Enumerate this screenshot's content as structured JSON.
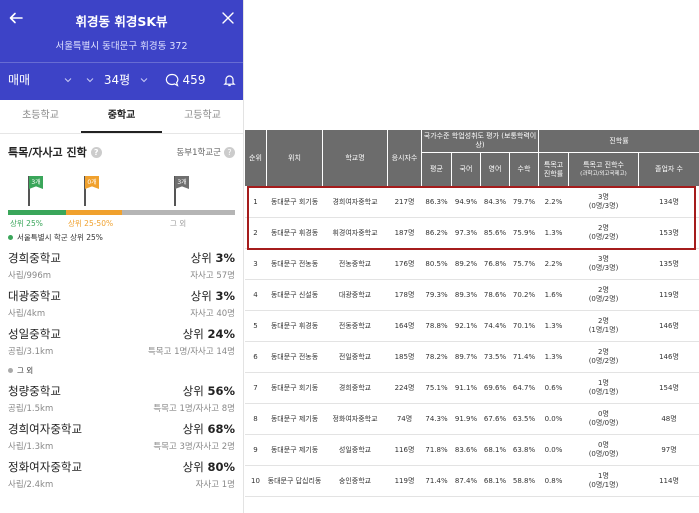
{
  "header": {
    "title": "휘경동 휘경SK뷰",
    "address": "서울특별시 동대문구 휘경동 372",
    "deal_type": "매매",
    "size": "34평",
    "talk_count": "459",
    "bg_color": "#3d43c7"
  },
  "tabs": [
    {
      "label": "초등학교"
    },
    {
      "label": "중학교",
      "active": true
    },
    {
      "label": "고등학교"
    }
  ],
  "section": {
    "title": "특목/자사고 진학",
    "district": "동부1학교군"
  },
  "flags": {
    "green": "3개",
    "orange": "0개",
    "gray": "3개"
  },
  "bar_labels": {
    "top25": "상위 25%",
    "top25_50": "상위 25-50%",
    "other": "그 외"
  },
  "groups": {
    "top_label": "서울특별시 학군 상위 25%",
    "other_label": "그 외"
  },
  "schools_top": [
    {
      "name": "경희중학교",
      "rank_prefix": "상위 ",
      "rank": "3%",
      "info": "사립/996m",
      "detail": "자사고 57명"
    },
    {
      "name": "대광중학교",
      "rank_prefix": "상위 ",
      "rank": "3%",
      "info": "사립/4km",
      "detail": "자사고 40명"
    },
    {
      "name": "성일중학교",
      "rank_prefix": "상위 ",
      "rank": "24%",
      "info": "공립/3.1km",
      "detail": "특목고 1명/자사고 14명"
    }
  ],
  "schools_other": [
    {
      "name": "청량중학교",
      "rank_prefix": "상위 ",
      "rank": "56%",
      "info": "공립/1.5km",
      "detail": "특목고 1명/자사고 8명"
    },
    {
      "name": "경희여자중학교",
      "rank_prefix": "상위 ",
      "rank": "68%",
      "info": "사립/1.3km",
      "detail": "특목고 3명/자사고 2명"
    },
    {
      "name": "정화여자중학교",
      "rank_prefix": "상위 ",
      "rank": "80%",
      "info": "사립/2.4km",
      "detail": "자사고 1명"
    }
  ],
  "table": {
    "headers": {
      "rank": "순위",
      "location": "위치",
      "school": "학교명",
      "applicants": "응시자수",
      "national_group": "국가수준 학업성취도 평가 (보통학력이상)",
      "avg": "평균",
      "korean": "국어",
      "english": "영어",
      "math": "수학",
      "advance_group": "진학률",
      "special_rate": "특목고 진학률",
      "special_count": "특목고 진학수",
      "special_count_sub": "(과학고/외고국제고)",
      "graduates": "졸업자 수"
    },
    "rows": [
      {
        "rank": "1",
        "loc": "동대문구 회기동",
        "school": "경희여자중학교",
        "app": "217명",
        "avg": "86.3%",
        "kor": "94.9%",
        "eng": "84.3%",
        "math": "79.7%",
        "rate": "2.2%",
        "cnt": "3명",
        "cnt_sub": "(0명/3명)",
        "grad": "134명"
      },
      {
        "rank": "2",
        "loc": "동대문구 휘경동",
        "school": "휘경여자중학교",
        "app": "187명",
        "avg": "86.2%",
        "kor": "97.3%",
        "eng": "85.6%",
        "math": "75.9%",
        "rate": "1.3%",
        "cnt": "2명",
        "cnt_sub": "(0명/2명)",
        "grad": "153명"
      },
      {
        "rank": "3",
        "loc": "동대문구 전농동",
        "school": "전농중학교",
        "app": "176명",
        "avg": "80.5%",
        "kor": "89.2%",
        "eng": "76.8%",
        "math": "75.7%",
        "rate": "2.2%",
        "cnt": "3명",
        "cnt_sub": "(0명/3명)",
        "grad": "135명"
      },
      {
        "rank": "4",
        "loc": "동대문구 신설동",
        "school": "대광중학교",
        "app": "178명",
        "avg": "79.3%",
        "kor": "89.3%",
        "eng": "78.6%",
        "math": "70.2%",
        "rate": "1.6%",
        "cnt": "2명",
        "cnt_sub": "(0명/2명)",
        "grad": "119명"
      },
      {
        "rank": "5",
        "loc": "동대문구 휘경동",
        "school": "전동중학교",
        "app": "164명",
        "avg": "78.8%",
        "kor": "92.1%",
        "eng": "74.4%",
        "math": "70.1%",
        "rate": "1.3%",
        "cnt": "2명",
        "cnt_sub": "(1명/1명)",
        "grad": "146명"
      },
      {
        "rank": "6",
        "loc": "동대문구 전농동",
        "school": "전일중학교",
        "app": "185명",
        "avg": "78.2%",
        "kor": "89.7%",
        "eng": "73.5%",
        "math": "71.4%",
        "rate": "1.3%",
        "cnt": "2명",
        "cnt_sub": "(0명/2명)",
        "grad": "146명"
      },
      {
        "rank": "7",
        "loc": "동대문구 회기동",
        "school": "경희중학교",
        "app": "224명",
        "avg": "75.1%",
        "kor": "91.1%",
        "eng": "69.6%",
        "math": "64.7%",
        "rate": "0.6%",
        "cnt": "1명",
        "cnt_sub": "(0명/1명)",
        "grad": "154명"
      },
      {
        "rank": "8",
        "loc": "동대문구 제기동",
        "school": "정화여자중학교",
        "app": "74명",
        "avg": "74.3%",
        "kor": "91.9%",
        "eng": "67.6%",
        "math": "63.5%",
        "rate": "0.0%",
        "cnt": "0명",
        "cnt_sub": "(0명/0명)",
        "grad": "48명"
      },
      {
        "rank": "9",
        "loc": "동대문구 제기동",
        "school": "성일중학교",
        "app": "116명",
        "avg": "71.8%",
        "kor": "83.6%",
        "eng": "68.1%",
        "math": "63.8%",
        "rate": "0.0%",
        "cnt": "0명",
        "cnt_sub": "(0명/0명)",
        "grad": "97명"
      },
      {
        "rank": "10",
        "loc": "동대문구 답십리동",
        "school": "숭인중학교",
        "app": "119명",
        "avg": "71.4%",
        "kor": "87.4%",
        "eng": "68.1%",
        "math": "58.8%",
        "rate": "0.8%",
        "cnt": "1명",
        "cnt_sub": "(0명/1명)",
        "grad": "114명"
      }
    ]
  }
}
